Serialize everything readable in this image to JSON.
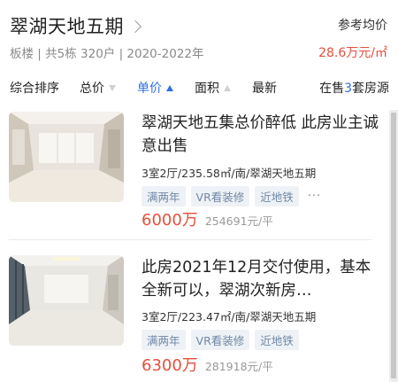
{
  "header": {
    "title": "翠湖天地五期",
    "subinfo": "板楼 | 共5栋 320户 | 2020-2022年",
    "ref_label": "参考均价",
    "ref_price": "28.6万元/㎡"
  },
  "sort": {
    "comprehensive": "综合排序",
    "total_price": "总价",
    "unit_price": "单价",
    "area": "面积",
    "latest": "最新",
    "count_prefix": "在售",
    "count_number": "3",
    "count_suffix": "套房源"
  },
  "listings": [
    {
      "title": "翠湖天地五集总价醉低 此房业主诚意出售",
      "meta": "3室2厅/235.58㎡/南/翠湖天地五期",
      "tags": [
        "满两年",
        "VR看装修",
        "近地铁"
      ],
      "more": "...",
      "total_price": "6000万",
      "unit_price": "254691元/平"
    },
    {
      "title": "此房2021年12月交付使用，基本全新可以，翠湖次新房…",
      "meta": "3室2厅/223.47㎡/南/翠湖天地五期",
      "tags": [
        "满两年",
        "VR看装修",
        "近地铁"
      ],
      "total_price": "6300万",
      "unit_price": "281918元/平"
    }
  ],
  "colors": {
    "accent": "#2f6fe0",
    "price": "#e4503c",
    "tag_bg": "#eef2f6",
    "tag_text": "#6f87a6"
  }
}
